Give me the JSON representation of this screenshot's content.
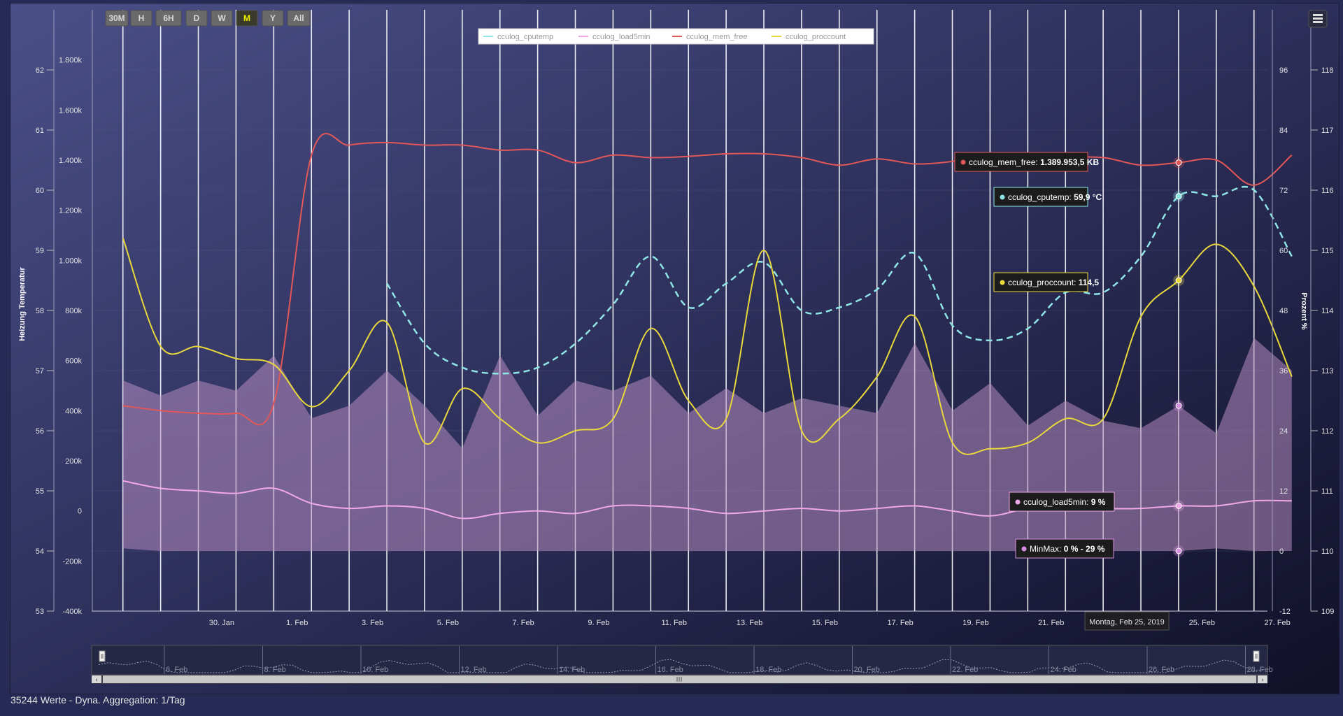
{
  "status_text": "35244 Werte - Dyna. Aggregation: 1/Tag",
  "range_buttons": [
    {
      "label": "30M",
      "active": false
    },
    {
      "label": "H",
      "active": false
    },
    {
      "label": "6H",
      "active": false
    },
    {
      "label": "D",
      "active": false
    },
    {
      "label": "W",
      "active": false
    },
    {
      "label": "M",
      "active": true
    },
    {
      "label": "Y",
      "active": false
    },
    {
      "label": "All",
      "active": false
    }
  ],
  "colors": {
    "cputemp": "#8fe6e6",
    "load5min": "#f0a8e8",
    "mem_free": "#e25757",
    "proccount": "#e8d83c",
    "minmax_fill": "#b48cc0",
    "accent_active": "#f0f000"
  },
  "tooltips": {
    "mem_free": {
      "series": "cculog_mem_free",
      "value": "1.389.953,5 KB"
    },
    "cputemp": {
      "series": "cculog_cputemp",
      "value": "59,9 °C"
    },
    "proccount": {
      "series": "cculog_proccount",
      "value": "114,5"
    },
    "load5min": {
      "series": "cculog_load5min",
      "value": "9 %"
    },
    "minmax": {
      "series": "MinMax",
      "value": "0 % - 29 %"
    }
  },
  "crosshair_label": "Montag, Feb 25, 2019",
  "navigator_labels": [
    "6. Feb",
    "8. Feb",
    "10. Feb",
    "12. Feb",
    "14. Feb",
    "16. Feb",
    "18. Feb",
    "20. Feb",
    "22. Feb",
    "24. Feb",
    "26. Feb",
    "28. Feb"
  ],
  "chart_data": {
    "type": "line",
    "legend_position": "top-center",
    "grid": true,
    "x": {
      "type": "date",
      "range": [
        "2019-01-28",
        "2019-02-28"
      ],
      "tick_labels": [
        "30. Jan",
        "1. Feb",
        "3. Feb",
        "5. Feb",
        "7. Feb",
        "9. Feb",
        "11. Feb",
        "13. Feb",
        "15. Feb",
        "17. Feb",
        "19. Feb",
        "21. Feb",
        "23. Feb",
        "25. Feb",
        "27. Feb"
      ]
    },
    "axes": [
      {
        "id": "temp",
        "label": "Heizung Temperatur",
        "side": "left",
        "range": [
          53,
          63
        ],
        "ticks": [
          "53",
          "54",
          "55",
          "56",
          "57",
          "58",
          "59",
          "60",
          "61",
          "62"
        ]
      },
      {
        "id": "mem",
        "label": "",
        "side": "left",
        "range": [
          -400000,
          2000000
        ],
        "ticks": [
          "-400k",
          "-200k",
          "0",
          "200k",
          "400k",
          "600k",
          "800k",
          "1.000k",
          "1.200k",
          "1.400k",
          "1.600k",
          "1.800k"
        ]
      },
      {
        "id": "pct",
        "label": "Prozent %",
        "side": "right",
        "range": [
          -12,
          108
        ],
        "ticks": [
          "-12",
          "0",
          "12",
          "24",
          "36",
          "48",
          "60",
          "72",
          "84",
          "96"
        ]
      },
      {
        "id": "proc",
        "label": "",
        "side": "right",
        "range": [
          109,
          119
        ],
        "ticks": [
          "109",
          "110",
          "111",
          "112",
          "113",
          "114",
          "115",
          "116",
          "117",
          "118"
        ]
      }
    ],
    "series": [
      {
        "name": "cculog_cputemp",
        "axis": "temp",
        "style": "dashed",
        "points": [
          [
            "2019-02-04",
            58.45
          ],
          [
            "2019-02-05",
            57.45
          ],
          [
            "2019-02-06",
            57.05
          ],
          [
            "2019-02-07",
            56.95
          ],
          [
            "2019-02-08",
            57.05
          ],
          [
            "2019-02-09",
            57.45
          ],
          [
            "2019-02-10",
            58.1
          ],
          [
            "2019-02-11",
            58.9
          ],
          [
            "2019-02-12",
            58.05
          ],
          [
            "2019-02-13",
            58.45
          ],
          [
            "2019-02-14",
            58.8
          ],
          [
            "2019-02-15",
            58.0
          ],
          [
            "2019-02-16",
            58.05
          ],
          [
            "2019-02-17",
            58.35
          ],
          [
            "2019-02-18",
            58.95
          ],
          [
            "2019-02-19",
            57.75
          ],
          [
            "2019-02-20",
            57.5
          ],
          [
            "2019-02-21",
            57.7
          ],
          [
            "2019-02-22",
            58.3
          ],
          [
            "2019-02-23",
            58.3
          ],
          [
            "2019-02-24",
            58.9
          ],
          [
            "2019-02-25",
            59.9
          ],
          [
            "2019-02-26",
            59.9
          ],
          [
            "2019-02-27",
            60.0
          ],
          [
            "2019-02-28",
            58.9
          ]
        ]
      },
      {
        "name": "cculog_load5min",
        "axis": "pct",
        "points": [
          [
            "2019-01-28",
            14
          ],
          [
            "2019-01-29",
            12.5
          ],
          [
            "2019-01-30",
            12
          ],
          [
            "2019-01-31",
            11.5
          ],
          [
            "2019-02-01",
            12.5
          ],
          [
            "2019-02-02",
            9.5
          ],
          [
            "2019-02-03",
            8.5
          ],
          [
            "2019-02-04",
            9
          ],
          [
            "2019-02-05",
            8.5
          ],
          [
            "2019-02-06",
            6.5
          ],
          [
            "2019-02-07",
            7.5
          ],
          [
            "2019-02-08",
            8
          ],
          [
            "2019-02-09",
            7.5
          ],
          [
            "2019-02-10",
            9
          ],
          [
            "2019-02-11",
            9
          ],
          [
            "2019-02-12",
            8.5
          ],
          [
            "2019-02-13",
            7.5
          ],
          [
            "2019-02-14",
            8
          ],
          [
            "2019-02-15",
            8.5
          ],
          [
            "2019-02-16",
            8
          ],
          [
            "2019-02-17",
            8.5
          ],
          [
            "2019-02-18",
            9
          ],
          [
            "2019-02-19",
            8
          ],
          [
            "2019-02-20",
            7
          ],
          [
            "2019-02-21",
            8.5
          ],
          [
            "2019-02-22",
            9
          ],
          [
            "2019-02-23",
            8.5
          ],
          [
            "2019-02-24",
            8.5
          ],
          [
            "2019-02-25",
            9
          ],
          [
            "2019-02-26",
            9
          ],
          [
            "2019-02-27",
            10
          ],
          [
            "2019-02-28",
            10
          ]
        ]
      },
      {
        "name": "cculog_mem_free",
        "axis": "mem",
        "points": [
          [
            "2019-01-28",
            420000
          ],
          [
            "2019-01-29",
            400000
          ],
          [
            "2019-01-30",
            390000
          ],
          [
            "2019-01-31",
            390000
          ],
          [
            "2019-02-01",
            430000
          ],
          [
            "2019-02-02",
            1420000
          ],
          [
            "2019-02-03",
            1460000
          ],
          [
            "2019-02-04",
            1470000
          ],
          [
            "2019-02-05",
            1460000
          ],
          [
            "2019-02-06",
            1460000
          ],
          [
            "2019-02-07",
            1440000
          ],
          [
            "2019-02-08",
            1440000
          ],
          [
            "2019-02-09",
            1390000
          ],
          [
            "2019-02-10",
            1420000
          ],
          [
            "2019-02-11",
            1410000
          ],
          [
            "2019-02-12",
            1415000
          ],
          [
            "2019-02-13",
            1425000
          ],
          [
            "2019-02-14",
            1425000
          ],
          [
            "2019-02-15",
            1410000
          ],
          [
            "2019-02-16",
            1380000
          ],
          [
            "2019-02-17",
            1405000
          ],
          [
            "2019-02-18",
            1385000
          ],
          [
            "2019-02-19",
            1395000
          ],
          [
            "2019-02-20",
            1420000
          ],
          [
            "2019-02-21",
            1400000
          ],
          [
            "2019-02-22",
            1410000
          ],
          [
            "2019-02-23",
            1410000
          ],
          [
            "2019-02-24",
            1380000
          ],
          [
            "2019-02-25",
            1389953.5
          ],
          [
            "2019-02-26",
            1400000
          ],
          [
            "2019-02-27",
            1300000
          ],
          [
            "2019-02-28",
            1420000
          ]
        ]
      },
      {
        "name": "cculog_proccount",
        "axis": "proc",
        "points": [
          [
            "2019-01-28",
            115.2
          ],
          [
            "2019-01-29",
            113.4
          ],
          [
            "2019-01-30",
            113.4
          ],
          [
            "2019-01-31",
            113.2
          ],
          [
            "2019-02-01",
            113.1
          ],
          [
            "2019-02-02",
            112.4
          ],
          [
            "2019-02-03",
            113.0
          ],
          [
            "2019-02-04",
            113.8
          ],
          [
            "2019-02-05",
            111.8
          ],
          [
            "2019-02-06",
            112.7
          ],
          [
            "2019-02-07",
            112.2
          ],
          [
            "2019-02-08",
            111.8
          ],
          [
            "2019-02-09",
            112.0
          ],
          [
            "2019-02-10",
            112.2
          ],
          [
            "2019-02-11",
            113.7
          ],
          [
            "2019-02-12",
            112.5
          ],
          [
            "2019-02-13",
            112.2
          ],
          [
            "2019-02-14",
            115.0
          ],
          [
            "2019-02-15",
            112.0
          ],
          [
            "2019-02-16",
            112.2
          ],
          [
            "2019-02-17",
            112.9
          ],
          [
            "2019-02-18",
            113.9
          ],
          [
            "2019-02-19",
            111.8
          ],
          [
            "2019-02-20",
            111.7
          ],
          [
            "2019-02-21",
            111.8
          ],
          [
            "2019-02-22",
            112.2
          ],
          [
            "2019-02-23",
            112.2
          ],
          [
            "2019-02-24",
            113.9
          ],
          [
            "2019-02-25",
            114.5
          ],
          [
            "2019-02-26",
            115.1
          ],
          [
            "2019-02-27",
            114.4
          ],
          [
            "2019-02-28",
            112.9
          ]
        ]
      },
      {
        "name": "MinMax",
        "axis": "pct",
        "type": "arearange",
        "points": [
          [
            "2019-01-28",
            0.5,
            34
          ],
          [
            "2019-01-29",
            0,
            31
          ],
          [
            "2019-01-30",
            0,
            34
          ],
          [
            "2019-01-31",
            0,
            32
          ],
          [
            "2019-02-01",
            0,
            39
          ],
          [
            "2019-02-02",
            0,
            26.5
          ],
          [
            "2019-02-03",
            0,
            29
          ],
          [
            "2019-02-04",
            0,
            36
          ],
          [
            "2019-02-05",
            0,
            29
          ],
          [
            "2019-02-06",
            0,
            20.5
          ],
          [
            "2019-02-07",
            0,
            39
          ],
          [
            "2019-02-08",
            0,
            27
          ],
          [
            "2019-02-09",
            0,
            34
          ],
          [
            "2019-02-10",
            0,
            32
          ],
          [
            "2019-02-11",
            0,
            35
          ],
          [
            "2019-02-12",
            0,
            27.5
          ],
          [
            "2019-02-13",
            0,
            32.5
          ],
          [
            "2019-02-14",
            0,
            27.5
          ],
          [
            "2019-02-15",
            0,
            30.5
          ],
          [
            "2019-02-16",
            0,
            29
          ],
          [
            "2019-02-17",
            0,
            27.5
          ],
          [
            "2019-02-18",
            0,
            41.5
          ],
          [
            "2019-02-19",
            0,
            28
          ],
          [
            "2019-02-20",
            0,
            33.5
          ],
          [
            "2019-02-21",
            0,
            25
          ],
          [
            "2019-02-22",
            0,
            30
          ],
          [
            "2019-02-23",
            0,
            26
          ],
          [
            "2019-02-24",
            0,
            24.5
          ],
          [
            "2019-02-25",
            0,
            29
          ],
          [
            "2019-02-26",
            0.5,
            23.5
          ],
          [
            "2019-02-27",
            0,
            42.5
          ],
          [
            "2019-02-28",
            0,
            36
          ]
        ]
      }
    ]
  }
}
